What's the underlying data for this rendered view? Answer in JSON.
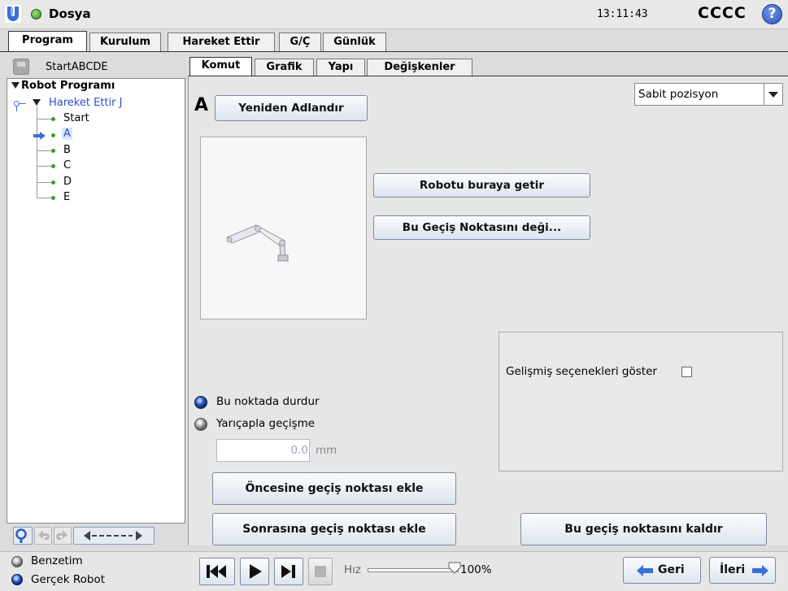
{
  "header": {
    "file_label": "Dosya",
    "clock": "13:11:43",
    "robot_name": "CCCC",
    "help_glyph": "?",
    "colors": {
      "status": "#2f8a18",
      "help": "#2d56bd",
      "logo": "#3a6fd8"
    }
  },
  "main_tabs": [
    {
      "label": "Program",
      "active": true
    },
    {
      "label": "Kurulum",
      "active": false
    },
    {
      "label": "Hareket Ettir",
      "active": false
    },
    {
      "label": "G/Ç",
      "active": false
    },
    {
      "label": "Günlük",
      "active": false
    }
  ],
  "left_panel": {
    "program_name": "StartABCDE",
    "tree": [
      {
        "label": "Robot Programı",
        "level": 0,
        "expanded": true
      },
      {
        "label": "Hareket Ettir J",
        "level": 1,
        "expanded": true
      },
      {
        "label": "Start",
        "level": 2
      },
      {
        "label": "A",
        "level": 2,
        "selected": true
      },
      {
        "label": "B",
        "level": 2
      },
      {
        "label": "C",
        "level": 2
      },
      {
        "label": "D",
        "level": 2
      },
      {
        "label": "E",
        "level": 2
      }
    ]
  },
  "sub_tabs": [
    {
      "label": "Komut",
      "active": true
    },
    {
      "label": "Grafik",
      "active": false
    },
    {
      "label": "Yapı",
      "active": false
    },
    {
      "label": "Değişkenler",
      "active": false
    }
  ],
  "command": {
    "waypoint_name": "A",
    "rename_button": "Yeniden Adlandır",
    "position_type": "Sabit pozisyon",
    "move_here_button": "Robotu buraya getir",
    "change_waypoint_button": "Bu Geçiş Noktasını deği...",
    "advanced_label": "Gelişmiş seçenekleri göster",
    "advanced_checked": false,
    "stop_option": "Bu noktada durdur",
    "blend_option": "Yarıçapla geçişme",
    "selected_option": "stop",
    "blend_radius_value": "0.0",
    "blend_radius_unit": "mm",
    "add_before_button": "Öncesine geçiş noktası ekle",
    "add_after_button": "Sonrasına geçiş noktası ekle",
    "remove_button": "Bu geçiş noktasını kaldır"
  },
  "footer": {
    "sim_label": "Benzetim",
    "real_label": "Gerçek Robot",
    "mode": "real",
    "speed_label": "Hız",
    "speed_value": "100%",
    "speed_fraction": 1.0,
    "back_button": "Geri",
    "next_button": "İleri"
  }
}
